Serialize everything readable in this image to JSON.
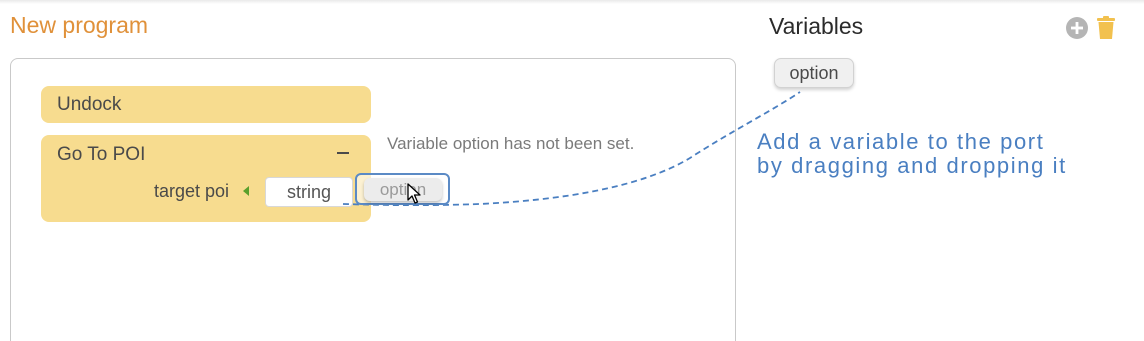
{
  "program": {
    "title": "New program"
  },
  "blocks": {
    "undock": {
      "title": "Undock"
    },
    "goto_poi": {
      "title": "Go To POI",
      "port_label": "target poi",
      "port_value": "string"
    }
  },
  "drag": {
    "chip_label": "option"
  },
  "warning": "Variable option has not been set.",
  "variables": {
    "title": "Variables",
    "items": [
      {
        "label": "option"
      }
    ]
  },
  "hint": {
    "line1": "Add a variable to the port",
    "line2": "by dragging and dropping it"
  },
  "icons": {
    "add": "plus-circle-icon",
    "delete": "trash-icon",
    "port_arrow": "caret-left-icon",
    "cursor": "mouse-pointer-icon"
  },
  "colors": {
    "title_orange": "#e0913a",
    "block_yellow": "#f7dc8f",
    "hint_blue": "#4a7fc1",
    "port_green": "#5aa02c"
  }
}
